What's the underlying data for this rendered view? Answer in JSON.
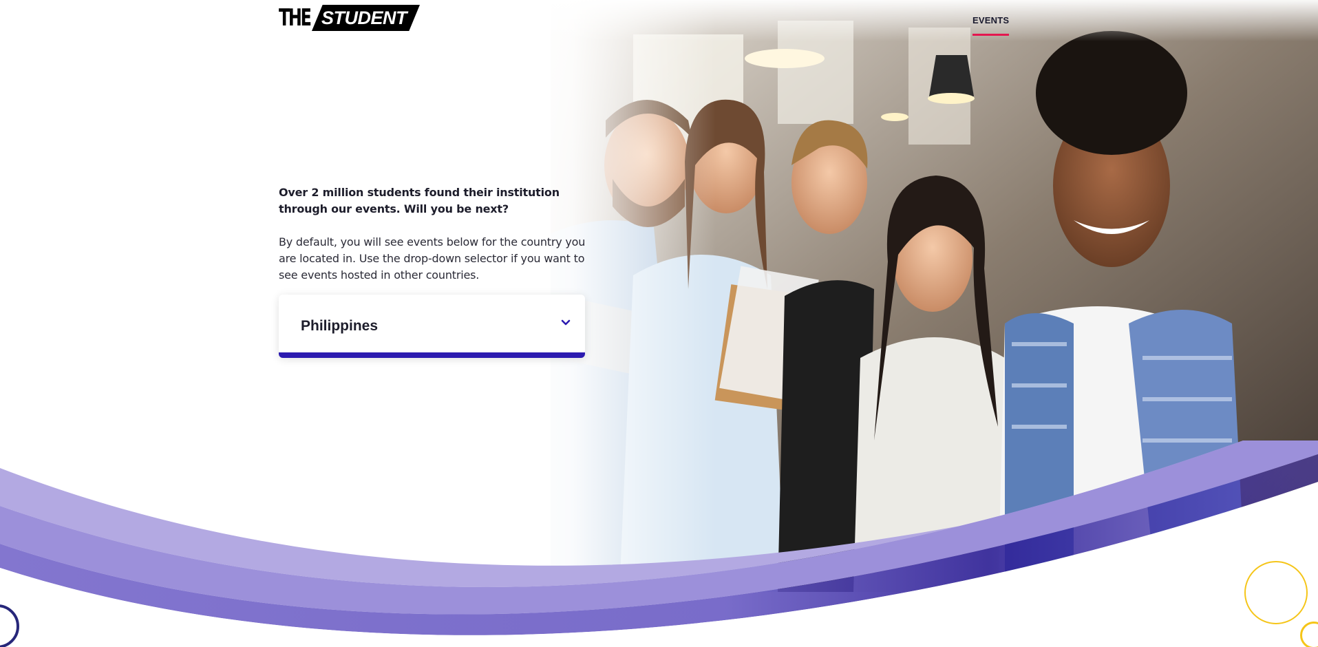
{
  "header": {
    "logo": {
      "the": "THE",
      "student": "STUDENT"
    },
    "nav": [
      {
        "label": "EVENTS",
        "active": true
      }
    ]
  },
  "intro": {
    "lead": "Over 2 million students found their institution through our events. Will you be next?",
    "body": "By default, you will see events below for the country you are located in. Use the drop-down selector if you want to see events hosted in other countries."
  },
  "country_select": {
    "value": "Philippines",
    "icon": "chevron-down-icon"
  },
  "colors": {
    "brand_purple": "#2c1bb0",
    "wave_light": "#b0a6e0",
    "wave_mid": "#7f72cf",
    "wave_dark": "#3b2aa8",
    "nav_underline": "#e4174f",
    "ring_yellow": "#f5c518",
    "ring_navy": "#27277a"
  }
}
